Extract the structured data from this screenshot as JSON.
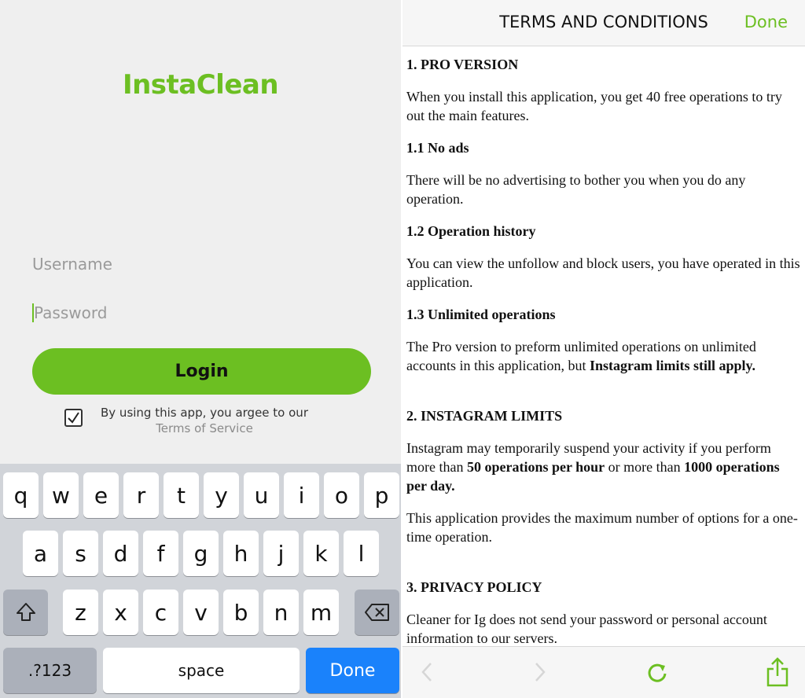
{
  "login": {
    "app_title": "InstaClean",
    "username_placeholder": "Username",
    "password_placeholder": "Password",
    "login_label": "Login",
    "agree_text": "By using this app, you argee to our",
    "terms_link": "Terms of Service",
    "agree_checked": true
  },
  "keyboard": {
    "row1": [
      "q",
      "w",
      "e",
      "r",
      "t",
      "y",
      "u",
      "i",
      "o",
      "p"
    ],
    "row2": [
      "a",
      "s",
      "d",
      "f",
      "g",
      "h",
      "j",
      "k",
      "l"
    ],
    "row3": [
      "z",
      "x",
      "c",
      "v",
      "b",
      "n",
      "m"
    ],
    "numbers_key": ".?123",
    "space_key": "space",
    "done_key": "Done",
    "shift_icon": "shift-icon",
    "backspace_icon": "backspace-icon"
  },
  "terms": {
    "header_title": "TERMS AND CONDITIONS",
    "done_label": "Done",
    "s1_title": "1. PRO VERSION",
    "s1_body": "When you install this application, you get 40 free operations to try out the main features.",
    "s11_title": "1.1 No ads",
    "s11_body": "There will be no advertising to bother you when you do any operation.",
    "s12_title": "1.2 Operation history",
    "s12_body": "You can view the unfollow and block users, you have operated in this application.",
    "s13_title": "1.3 Unlimited operations",
    "s13_body": "The Pro version to preform unlimited operations on unlimited accounts in this application, but",
    "s13_bold": "Instagram limits still apply.",
    "s2_title": "2. INSTAGRAM LIMITS",
    "s2_body_a": "Instagram may temporarily suspend your activity if you perform more than",
    "s2_bold_a": "50 operations per hour",
    "s2_body_b": "or more than",
    "s2_bold_b": "1000 operations per day.",
    "s2_body2": "This application provides the maximum number of options for a one-time operation.",
    "s3_title": "3. PRIVACY POLICY",
    "s3_body": "Cleaner for Ig does not send your password or personal account information to our servers."
  },
  "toolbar": {
    "back_icon": "chevron-left-icon",
    "forward_icon": "chevron-right-icon",
    "reload_icon": "reload-icon",
    "share_icon": "share-icon"
  },
  "colors": {
    "accent": "#6cbf22",
    "keyboard_bg": "#d1d4d9",
    "done_key_blue": "#1a82fb"
  }
}
